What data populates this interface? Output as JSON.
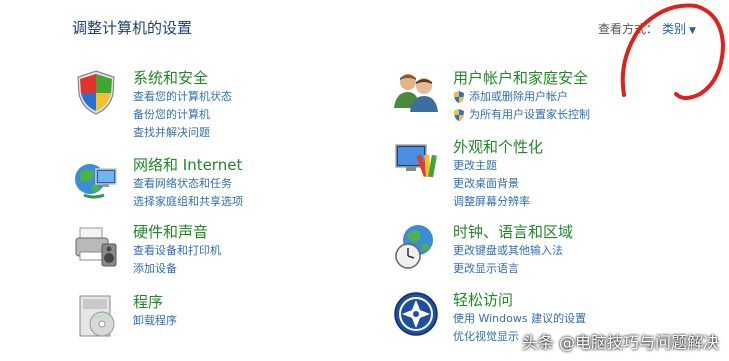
{
  "header": {
    "title": "调整计算机的设置",
    "view_by_label": "查看方式：",
    "view_by_value": "类别"
  },
  "left": [
    {
      "title": "系统和安全",
      "links": [
        "查看您的计算机状态",
        "备份您的计算机",
        "查找并解决问题"
      ]
    },
    {
      "title": "网络和 Internet",
      "links": [
        "查看网络状态和任务",
        "选择家庭组和共享选项"
      ]
    },
    {
      "title": "硬件和声音",
      "links": [
        "查看设备和打印机",
        "添加设备"
      ]
    },
    {
      "title": "程序",
      "links": [
        "卸载程序"
      ]
    }
  ],
  "right": [
    {
      "title": "用户帐户和家庭安全",
      "links": [
        "添加或删除用户帐户",
        "为所有用户设置家长控制"
      ]
    },
    {
      "title": "外观和个性化",
      "links": [
        "更改主题",
        "更改桌面背景",
        "调整屏幕分辨率"
      ]
    },
    {
      "title": "时钟、语言和区域",
      "links": [
        "更改键盘或其他输入法",
        "更改显示语言"
      ]
    },
    {
      "title": "轻松访问",
      "links": [
        "使用 Windows 建议的设置",
        "优化视觉显示"
      ]
    }
  ],
  "watermark": "头条 @电脑技巧与问题解决",
  "colors": {
    "title_green": "#1f8a25",
    "link_blue": "#2e6fb7",
    "annotation_red": "#e0201b"
  }
}
